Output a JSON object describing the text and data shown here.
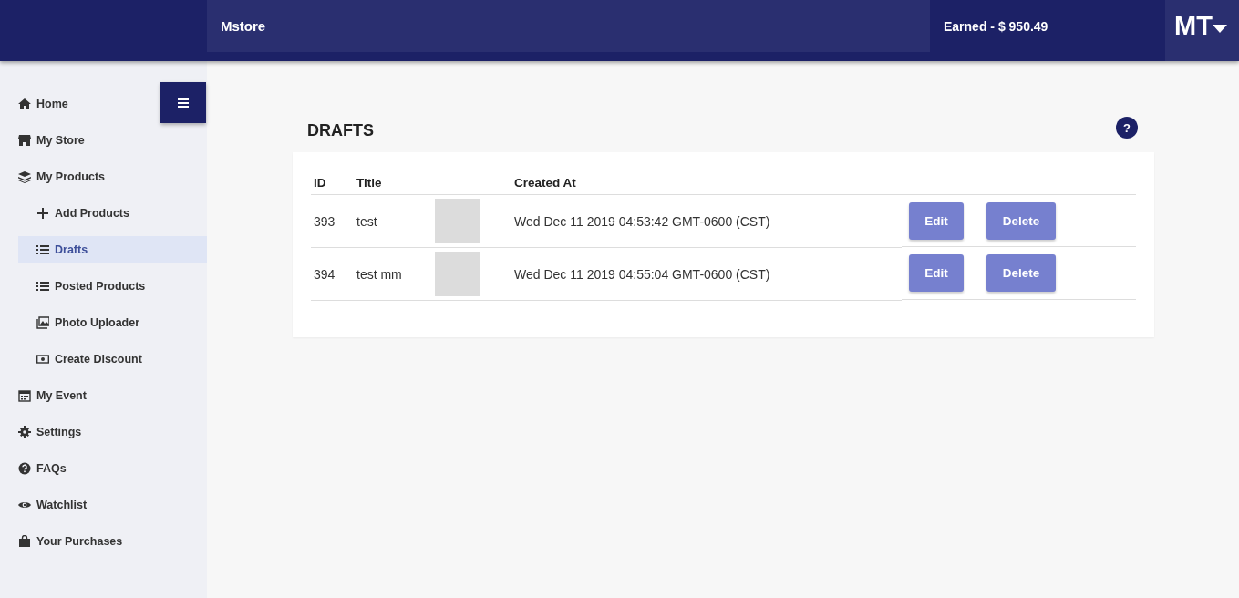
{
  "header": {
    "brand": "Mstore",
    "earned": "Earned - $ 950.49",
    "user_initials": "MT"
  },
  "sidebar": {
    "items": [
      {
        "label": "Home",
        "selected": false
      },
      {
        "label": "My Store",
        "selected": false
      },
      {
        "label": "My Products",
        "selected": false,
        "children": [
          {
            "label": "Add Products",
            "selected": false
          },
          {
            "label": "Drafts",
            "selected": true
          },
          {
            "label": "Posted Products",
            "selected": false
          },
          {
            "label": "Photo Uploader",
            "selected": false
          },
          {
            "label": "Create Discount",
            "selected": false
          }
        ]
      },
      {
        "label": "My Event",
        "selected": false
      },
      {
        "label": "Settings",
        "selected": false
      },
      {
        "label": "FAQs",
        "selected": false
      },
      {
        "label": "Watchlist",
        "selected": false
      },
      {
        "label": "Your Purchases",
        "selected": false
      }
    ]
  },
  "page": {
    "title": "DRAFTS",
    "help": "?"
  },
  "table": {
    "columns": [
      "ID",
      "Title",
      "Created At"
    ],
    "rows": [
      {
        "id": "393",
        "title": "test",
        "created_at": "Wed Dec 11 2019 04:53:42 GMT-0600 (CST)",
        "actions": [
          "Edit",
          "Delete"
        ]
      },
      {
        "id": "394",
        "title": "test mm",
        "created_at": "Wed Dec 11 2019 04:55:04 GMT-0600 (CST)",
        "actions": [
          "Edit",
          "Delete"
        ]
      }
    ]
  }
}
